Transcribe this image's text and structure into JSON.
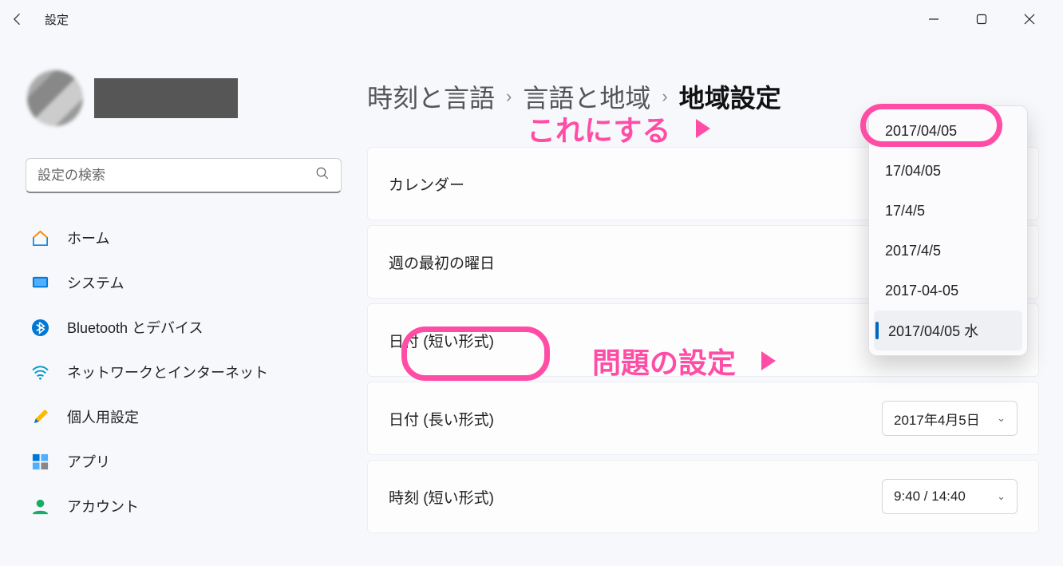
{
  "titlebar": {
    "title": "設定"
  },
  "search": {
    "placeholder": "設定の検索"
  },
  "nav": [
    {
      "label": "ホーム",
      "icon": "home"
    },
    {
      "label": "システム",
      "icon": "system"
    },
    {
      "label": "Bluetooth とデバイス",
      "icon": "bluetooth"
    },
    {
      "label": "ネットワークとインターネット",
      "icon": "wifi"
    },
    {
      "label": "個人用設定",
      "icon": "personalize"
    },
    {
      "label": "アプリ",
      "icon": "apps"
    },
    {
      "label": "アカウント",
      "icon": "account"
    }
  ],
  "breadcrumb": {
    "part1": "時刻と言語",
    "part2": "言語と地域",
    "current": "地域設定",
    "sep": "›"
  },
  "rows": {
    "calendar": "カレンダー",
    "firstDay": "週の最初の曜日",
    "shortDate": "日付 (短い形式)",
    "longDate": "日付 (長い形式)",
    "shortTime": "時刻 (短い形式)"
  },
  "values": {
    "longDate": "2017年4月5日",
    "shortTime": "9:40 / 14:40"
  },
  "dropdown": [
    "2017/04/05",
    "17/04/05",
    "17/4/5",
    "2017/4/5",
    "2017-04-05",
    "2017/04/05 水"
  ],
  "annotations": {
    "choose": "これにする",
    "problem": "問題の設定"
  }
}
